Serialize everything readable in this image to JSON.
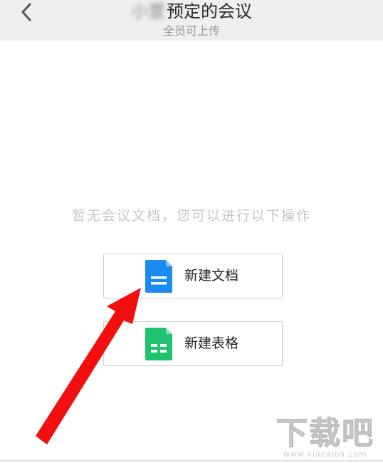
{
  "header": {
    "title_blurred": "小萱",
    "title": "预定的会议",
    "subtitle": "全员可上传"
  },
  "empty_state": {
    "message": "暂无会议文档，您可以进行以下操作"
  },
  "actions": [
    {
      "label": "新建文档",
      "icon": "doc-file-icon",
      "color": "#1a8cf0"
    },
    {
      "label": "新建表格",
      "icon": "sheet-file-icon",
      "color": "#1fc36e"
    }
  ],
  "watermark": {
    "main": "下载吧",
    "url": "www.xiazaiba.com"
  },
  "colors": {
    "annotation_arrow": "#f20f0f"
  }
}
